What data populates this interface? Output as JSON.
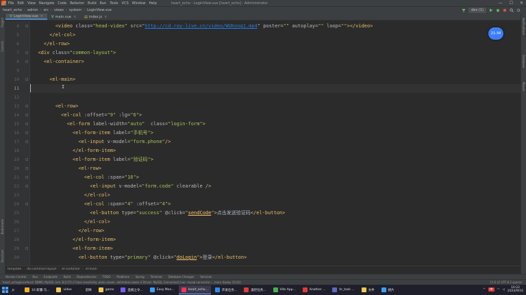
{
  "menubar": {
    "items": [
      "File",
      "Edit",
      "View",
      "Navigate",
      "Code",
      "Refactor",
      "Build",
      "Run",
      "Tools",
      "VCS",
      "Window",
      "Help"
    ],
    "window_title": "heart_echo - LoginView.vue [heart_echo] - Administrator"
  },
  "navbar": {
    "crumbs": [
      "heart_echo",
      "admin",
      "src",
      "views",
      "system",
      "LoginView.vue"
    ],
    "run_config": "dev (1)"
  },
  "tabs": [
    {
      "label": "LoginView.vue",
      "kind": "vue",
      "active": true
    },
    {
      "label": "main.vue",
      "kind": "vue",
      "active": false
    },
    {
      "label": "index.js",
      "kind": "js",
      "active": false
    }
  ],
  "left_tool_labels": [
    "Project",
    "Commit",
    "Bookmarks",
    "Structure"
  ],
  "right_tool_labels": [
    "Notifications",
    "Database",
    "Maven"
  ],
  "clock_bubble": "21:34",
  "code_lines": [
    {
      "n": "4",
      "parts": [
        [
          "plain",
          "        "
        ],
        [
          "tag",
          "<video "
        ],
        [
          "attr",
          "class="
        ],
        [
          "val",
          "\"head-video\" "
        ],
        [
          "attr",
          "src="
        ],
        [
          "val",
          "\""
        ],
        [
          "link",
          "http://cd.ray-live.cn/video/WUKong1.mp4"
        ],
        [
          "val",
          "\" "
        ],
        [
          "attr",
          "poster="
        ],
        [
          "val",
          "\"\" "
        ],
        [
          "attr",
          "autoplay="
        ],
        [
          "val",
          "\"\" "
        ],
        [
          "attr",
          "loop="
        ],
        [
          "val",
          "\"\""
        ],
        [
          "tag",
          "></video>"
        ]
      ]
    },
    {
      "n": "5",
      "parts": [
        [
          "plain",
          "      "
        ],
        [
          "tag",
          "</el-col>"
        ]
      ]
    },
    {
      "n": "6",
      "parts": [
        [
          "plain",
          "    "
        ],
        [
          "tag",
          "</el-row>"
        ]
      ]
    },
    {
      "n": "7",
      "parts": [
        [
          "plain",
          "  "
        ],
        [
          "tag",
          "<div "
        ],
        [
          "attr",
          "class="
        ],
        [
          "val",
          "\"common-layout\""
        ],
        [
          "tag",
          ">"
        ]
      ]
    },
    {
      "n": "8",
      "parts": [
        [
          "plain",
          "    "
        ],
        [
          "tag",
          "<el-container>"
        ]
      ]
    },
    {
      "n": "9",
      "parts": []
    },
    {
      "n": "10",
      "parts": [
        [
          "plain",
          "      "
        ],
        [
          "tag",
          "<el-main>"
        ]
      ]
    },
    {
      "n": "11",
      "parts": [],
      "current": true
    },
    {
      "n": "12",
      "parts": []
    },
    {
      "n": "13",
      "parts": [
        [
          "plain",
          "        "
        ],
        [
          "tag",
          "<el-row>"
        ]
      ]
    },
    {
      "n": "14",
      "parts": [
        [
          "plain",
          "          "
        ],
        [
          "tag",
          "<el-col "
        ],
        [
          "attr",
          ":offset="
        ],
        [
          "val",
          "\"9\" "
        ],
        [
          "attr",
          ":lg="
        ],
        [
          "val",
          "\"6\""
        ],
        [
          "tag",
          ">"
        ]
      ]
    },
    {
      "n": "15",
      "parts": [
        [
          "plain",
          "            "
        ],
        [
          "tag",
          "<el-form "
        ],
        [
          "attr",
          "label-width="
        ],
        [
          "val",
          "\"auto\"  "
        ],
        [
          "attr",
          "class="
        ],
        [
          "val",
          "\"login-form\""
        ],
        [
          "tag",
          ">"
        ]
      ]
    },
    {
      "n": "16",
      "parts": [
        [
          "plain",
          "              "
        ],
        [
          "tag",
          "<el-form-item "
        ],
        [
          "attr",
          "label="
        ],
        [
          "val",
          "\"手机号\""
        ],
        [
          "tag",
          ">"
        ]
      ]
    },
    {
      "n": "17",
      "parts": [
        [
          "plain",
          "                "
        ],
        [
          "tag",
          "<el-input "
        ],
        [
          "attr",
          "v-model="
        ],
        [
          "val",
          "\"form.phone\""
        ],
        [
          "tag",
          "/>"
        ]
      ]
    },
    {
      "n": "18",
      "parts": [
        [
          "plain",
          "              "
        ],
        [
          "tag",
          "</el-form-item>"
        ]
      ]
    },
    {
      "n": "19",
      "parts": [
        [
          "plain",
          "              "
        ],
        [
          "tag",
          "<el-form-item "
        ],
        [
          "attr",
          "label="
        ],
        [
          "val",
          "\"验证码\""
        ],
        [
          "tag",
          ">"
        ]
      ]
    },
    {
      "n": "20",
      "parts": [
        [
          "plain",
          "                "
        ],
        [
          "tag",
          "<el-row>"
        ]
      ]
    },
    {
      "n": "21",
      "parts": [
        [
          "plain",
          "                  "
        ],
        [
          "tag",
          "<el-col "
        ],
        [
          "attr",
          ":span="
        ],
        [
          "val",
          "\"16\""
        ],
        [
          "tag",
          ">"
        ]
      ]
    },
    {
      "n": "22",
      "parts": [
        [
          "plain",
          "                    "
        ],
        [
          "tag",
          "<el-input "
        ],
        [
          "attr",
          "v-model="
        ],
        [
          "val",
          "\"form.code\" "
        ],
        [
          "attr",
          "clearable "
        ],
        [
          "tag",
          "/>"
        ]
      ]
    },
    {
      "n": "23",
      "parts": [
        [
          "plain",
          "                  "
        ],
        [
          "tag",
          "</el-col>"
        ]
      ]
    },
    {
      "n": "24",
      "parts": [
        [
          "plain",
          "                  "
        ],
        [
          "tag",
          "<el-col "
        ],
        [
          "attr",
          ":span="
        ],
        [
          "val",
          "\"4\" "
        ],
        [
          "attr",
          ":offset="
        ],
        [
          "val",
          "\"4\""
        ],
        [
          "tag",
          ">"
        ]
      ]
    },
    {
      "n": "25",
      "parts": [
        [
          "plain",
          "                    "
        ],
        [
          "tag",
          "<el-button "
        ],
        [
          "attr",
          "type="
        ],
        [
          "val",
          "\"success\" "
        ],
        [
          "attr",
          "@click="
        ],
        [
          "val",
          "\""
        ],
        [
          "fn",
          "sendCode"
        ],
        [
          "val",
          "\""
        ],
        [
          "tag",
          ">"
        ],
        [
          "text",
          "点击发送验证码"
        ],
        [
          "tag",
          "</el-button>"
        ]
      ]
    },
    {
      "n": "26",
      "parts": [
        [
          "plain",
          "                  "
        ],
        [
          "tag",
          "</el-col>"
        ]
      ]
    },
    {
      "n": "27",
      "parts": [
        [
          "plain",
          "                "
        ],
        [
          "tag",
          "</el-row>"
        ]
      ]
    },
    {
      "n": "28",
      "parts": [
        [
          "plain",
          "              "
        ],
        [
          "tag",
          "</el-form-item>"
        ]
      ]
    },
    {
      "n": "29",
      "parts": [
        [
          "plain",
          "              "
        ],
        [
          "tag",
          "<el-form-item>"
        ]
      ]
    },
    {
      "n": "30",
      "parts": [
        [
          "plain",
          "                "
        ],
        [
          "tag",
          "<el-button "
        ],
        [
          "attr",
          "type="
        ],
        [
          "val",
          "\"primary\" "
        ],
        [
          "attr",
          "@click="
        ],
        [
          "val",
          "\""
        ],
        [
          "fn",
          "doLogin"
        ],
        [
          "val",
          "\""
        ],
        [
          "tag",
          ">"
        ],
        [
          "text",
          "登录"
        ],
        [
          "tag",
          "</el-button>"
        ]
      ]
    }
  ],
  "cursor_glyph": "I",
  "breadcrumb": [
    "template",
    "div.common-layout",
    "el-container",
    "el-main"
  ],
  "tool_windows": [
    "Version Control",
    "Run",
    "Endpoints",
    "Build",
    "Dependencies",
    "TODO",
    "Problems",
    "Spring",
    "Terminal",
    "Database Changes",
    "Services"
  ],
  "status": {
    "message": "heart_echo@localhost: DBMS: MySQL (ver. 8.0.37) // Case sensitivity: plain=lower, delimited=lower // Driver: MySQL Connector/J (ver. mysql-connector-... more (today 10:42)",
    "right": "11:5  LF  UTF-8  2 spaces"
  },
  "taskbar": {
    "items": [
      {
        "label": "10 新疆·乌...",
        "color": "#f2b01e"
      },
      {
        "label": "video",
        "color": "#f2c94c"
      },
      {
        "label": "剪映",
        "color": "#222222"
      },
      {
        "label": "game",
        "color": "#f2c94c"
      },
      {
        "label": "圣痕之令...",
        "color": "#7a5cff"
      },
      {
        "label": "Easy Mon...",
        "color": "#3aa0ff"
      },
      {
        "label": "heart_echo...",
        "color": "#fe315d",
        "active": true
      },
      {
        "label": "开发任务...",
        "color": "#2d8cf0"
      },
      {
        "label": "遥控任务...",
        "color": "#e53935"
      },
      {
        "label": "Vite App...",
        "color": "#4caf50"
      },
      {
        "label": "Another ...",
        "color": "#e53935"
      },
      {
        "label": "hr_task ...",
        "color": "#5c6bc0"
      },
      {
        "label": "文件",
        "color": "#f2c94c"
      },
      {
        "label": "相片",
        "color": "#3aa0ff"
      }
    ],
    "ime": "中",
    "time": "10:22",
    "date": "2024/9/16"
  }
}
